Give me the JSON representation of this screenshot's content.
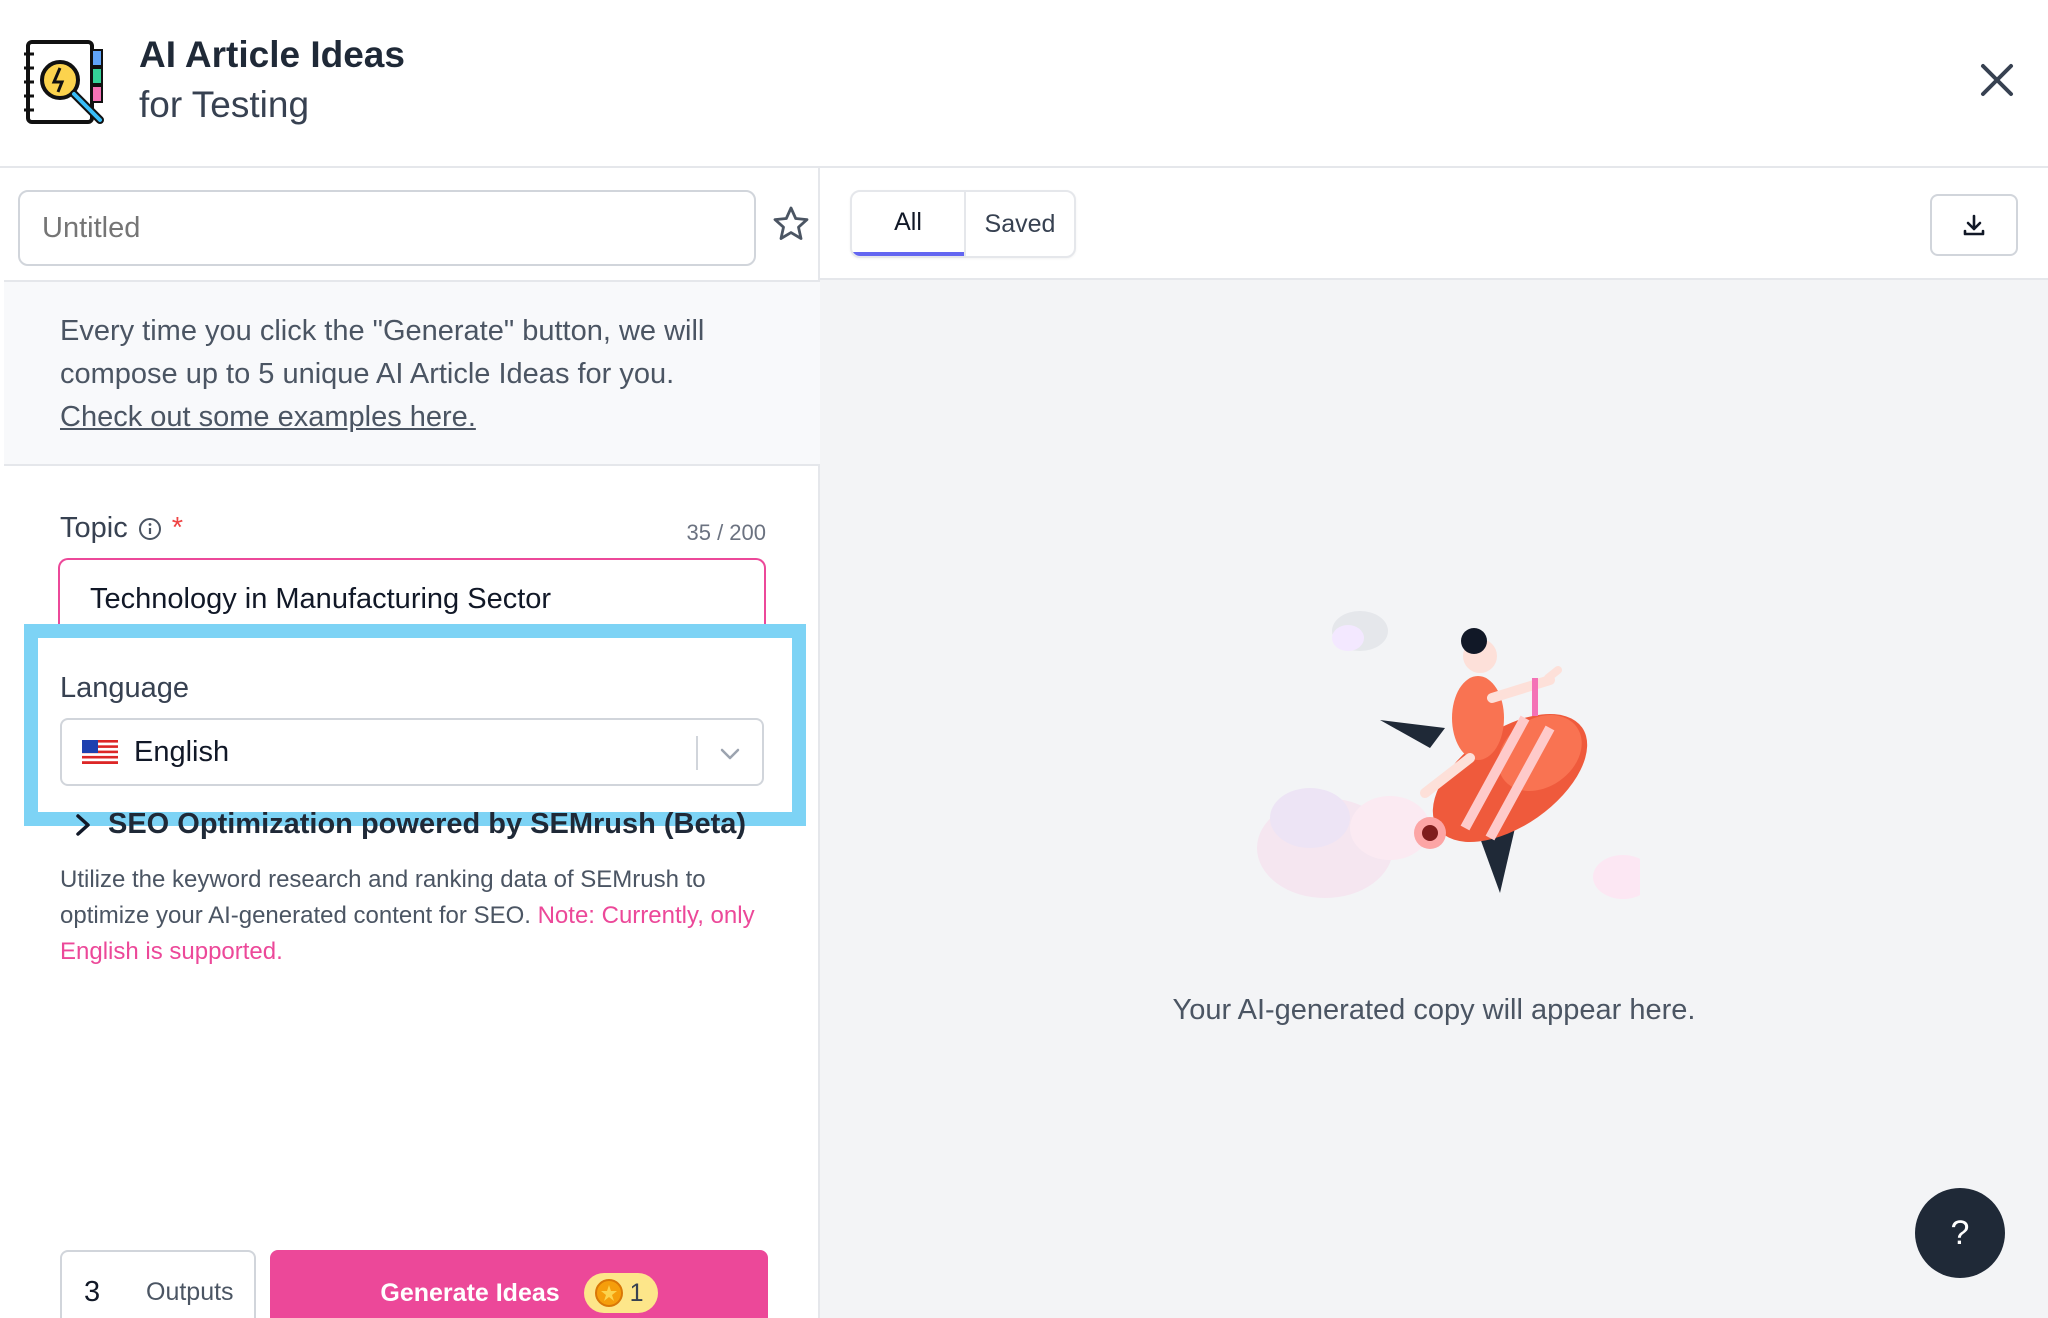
{
  "header": {
    "title": "AI Article Ideas",
    "subtitle": "for Testing",
    "icon": "lightbulb-notebook-icon",
    "close_icon": "close-icon"
  },
  "left": {
    "doc_title_placeholder": "Untitled",
    "star_icon": "star-icon",
    "info": {
      "text": "Every time you click the \"Generate\" button, we will compose up to 5 unique AI Article Ideas for you. ",
      "link": "Check out some examples here."
    },
    "topic": {
      "label": "Topic",
      "required_mark": "*",
      "char_count": "35 / 200",
      "value": "Technology in Manufacturing Sector"
    },
    "language": {
      "label": "Language",
      "value": "English",
      "flag": "us-flag-icon"
    },
    "seo": {
      "title": "SEO Optimization powered by SEMrush (Beta)",
      "description": "Utilize the keyword research and ranking data of SEMrush to optimize your AI-generated content for SEO. ",
      "note": "Note: Currently, only English is supported."
    },
    "outputs": {
      "value": "3",
      "label": "Outputs"
    },
    "generate": {
      "label": "Generate Ideas",
      "credits": "1"
    }
  },
  "right": {
    "tabs": [
      {
        "label": "All",
        "active": true
      },
      {
        "label": "Saved",
        "active": false
      }
    ],
    "download_icon": "download-icon",
    "empty_message": "Your AI-generated copy will appear here.",
    "help_label": "?"
  },
  "colors": {
    "accent": "#ec4899",
    "highlight": "#7dd3f5",
    "tab_indicator": "#6366f1"
  }
}
